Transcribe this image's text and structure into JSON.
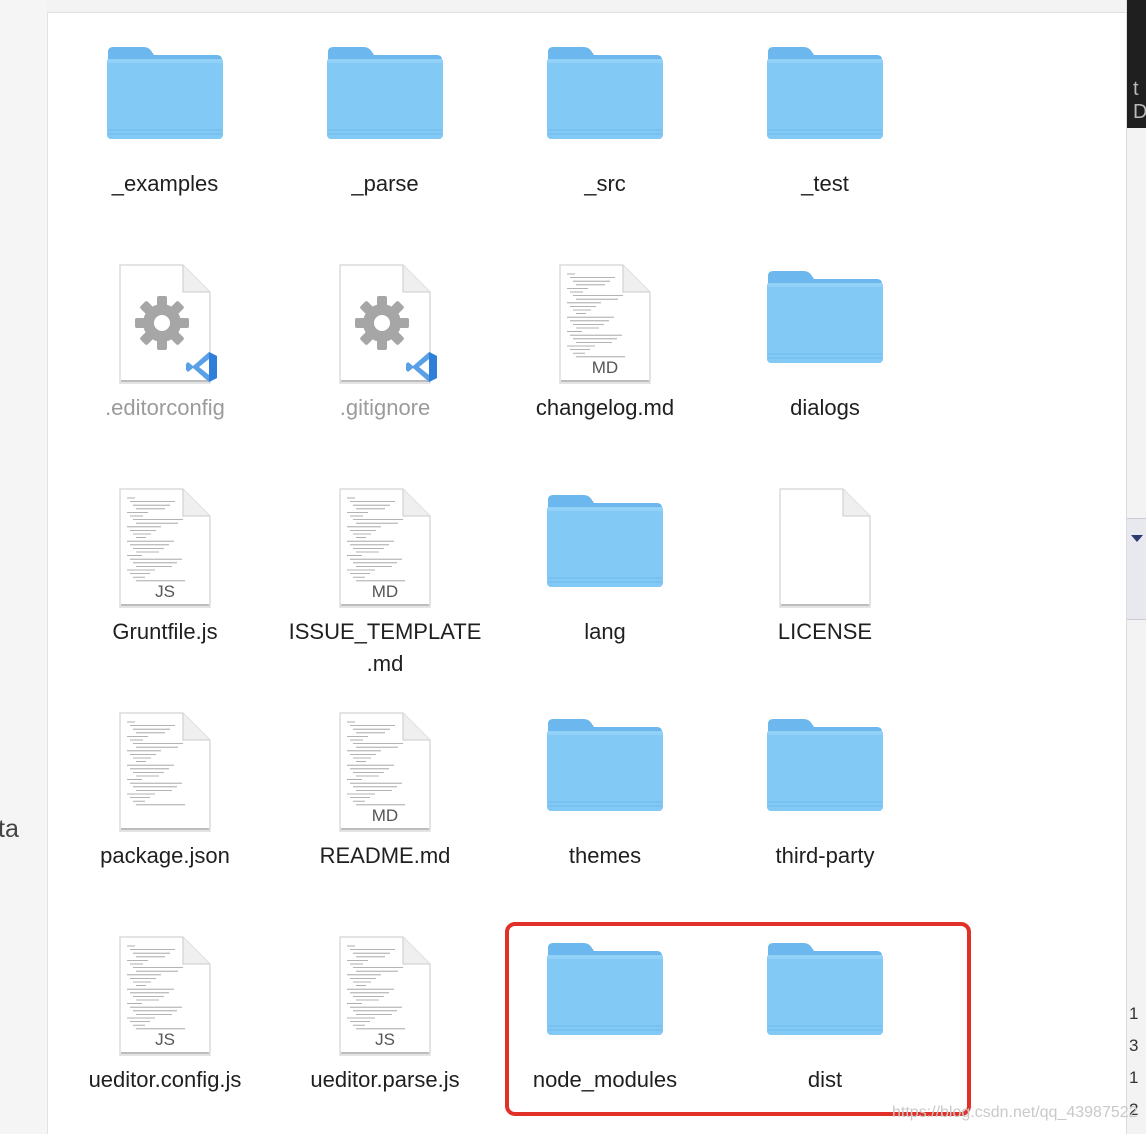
{
  "window": {
    "sidebar_cut_text": "ta",
    "right_edge_text": "t D",
    "right_edge_numbers": [
      "1",
      "3",
      "1",
      "2"
    ]
  },
  "files": [
    {
      "label": "_examples",
      "kind": "folder"
    },
    {
      "label": "_parse",
      "kind": "folder"
    },
    {
      "label": "_src",
      "kind": "folder"
    },
    {
      "label": "_test",
      "kind": "folder"
    },
    {
      "label": ".editorconfig",
      "kind": "config",
      "dim": true
    },
    {
      "label": ".gitignore",
      "kind": "config",
      "dim": true
    },
    {
      "label": "changelog.md",
      "kind": "doc",
      "ext": "MD"
    },
    {
      "label": "dialogs",
      "kind": "folder"
    },
    {
      "label": "Gruntfile.js",
      "kind": "doc",
      "ext": "JS"
    },
    {
      "label": "ISSUE_TEMPLATE\n.md",
      "kind": "doc",
      "ext": "MD"
    },
    {
      "label": "lang",
      "kind": "folder"
    },
    {
      "label": "LICENSE",
      "kind": "blank"
    },
    {
      "label": "package.json",
      "kind": "doc",
      "ext": ""
    },
    {
      "label": "README.md",
      "kind": "doc",
      "ext": "MD"
    },
    {
      "label": "themes",
      "kind": "folder"
    },
    {
      "label": "third-party",
      "kind": "folder"
    },
    {
      "label": "ueditor.config.js",
      "kind": "doc",
      "ext": "JS"
    },
    {
      "label": "ueditor.parse.js",
      "kind": "doc",
      "ext": "JS"
    },
    {
      "label": "node_modules",
      "kind": "folder",
      "highlighted": true
    },
    {
      "label": "dist",
      "kind": "folder",
      "highlighted": true
    }
  ],
  "watermark": "https://blog.csdn.net/qq_43987522",
  "colors": {
    "folder": "#7cc5f5",
    "folder_tab": "#6cb8ee",
    "highlight": "#e03027",
    "gear": "#a6a6a6",
    "vscode": "#2f7ed8"
  }
}
